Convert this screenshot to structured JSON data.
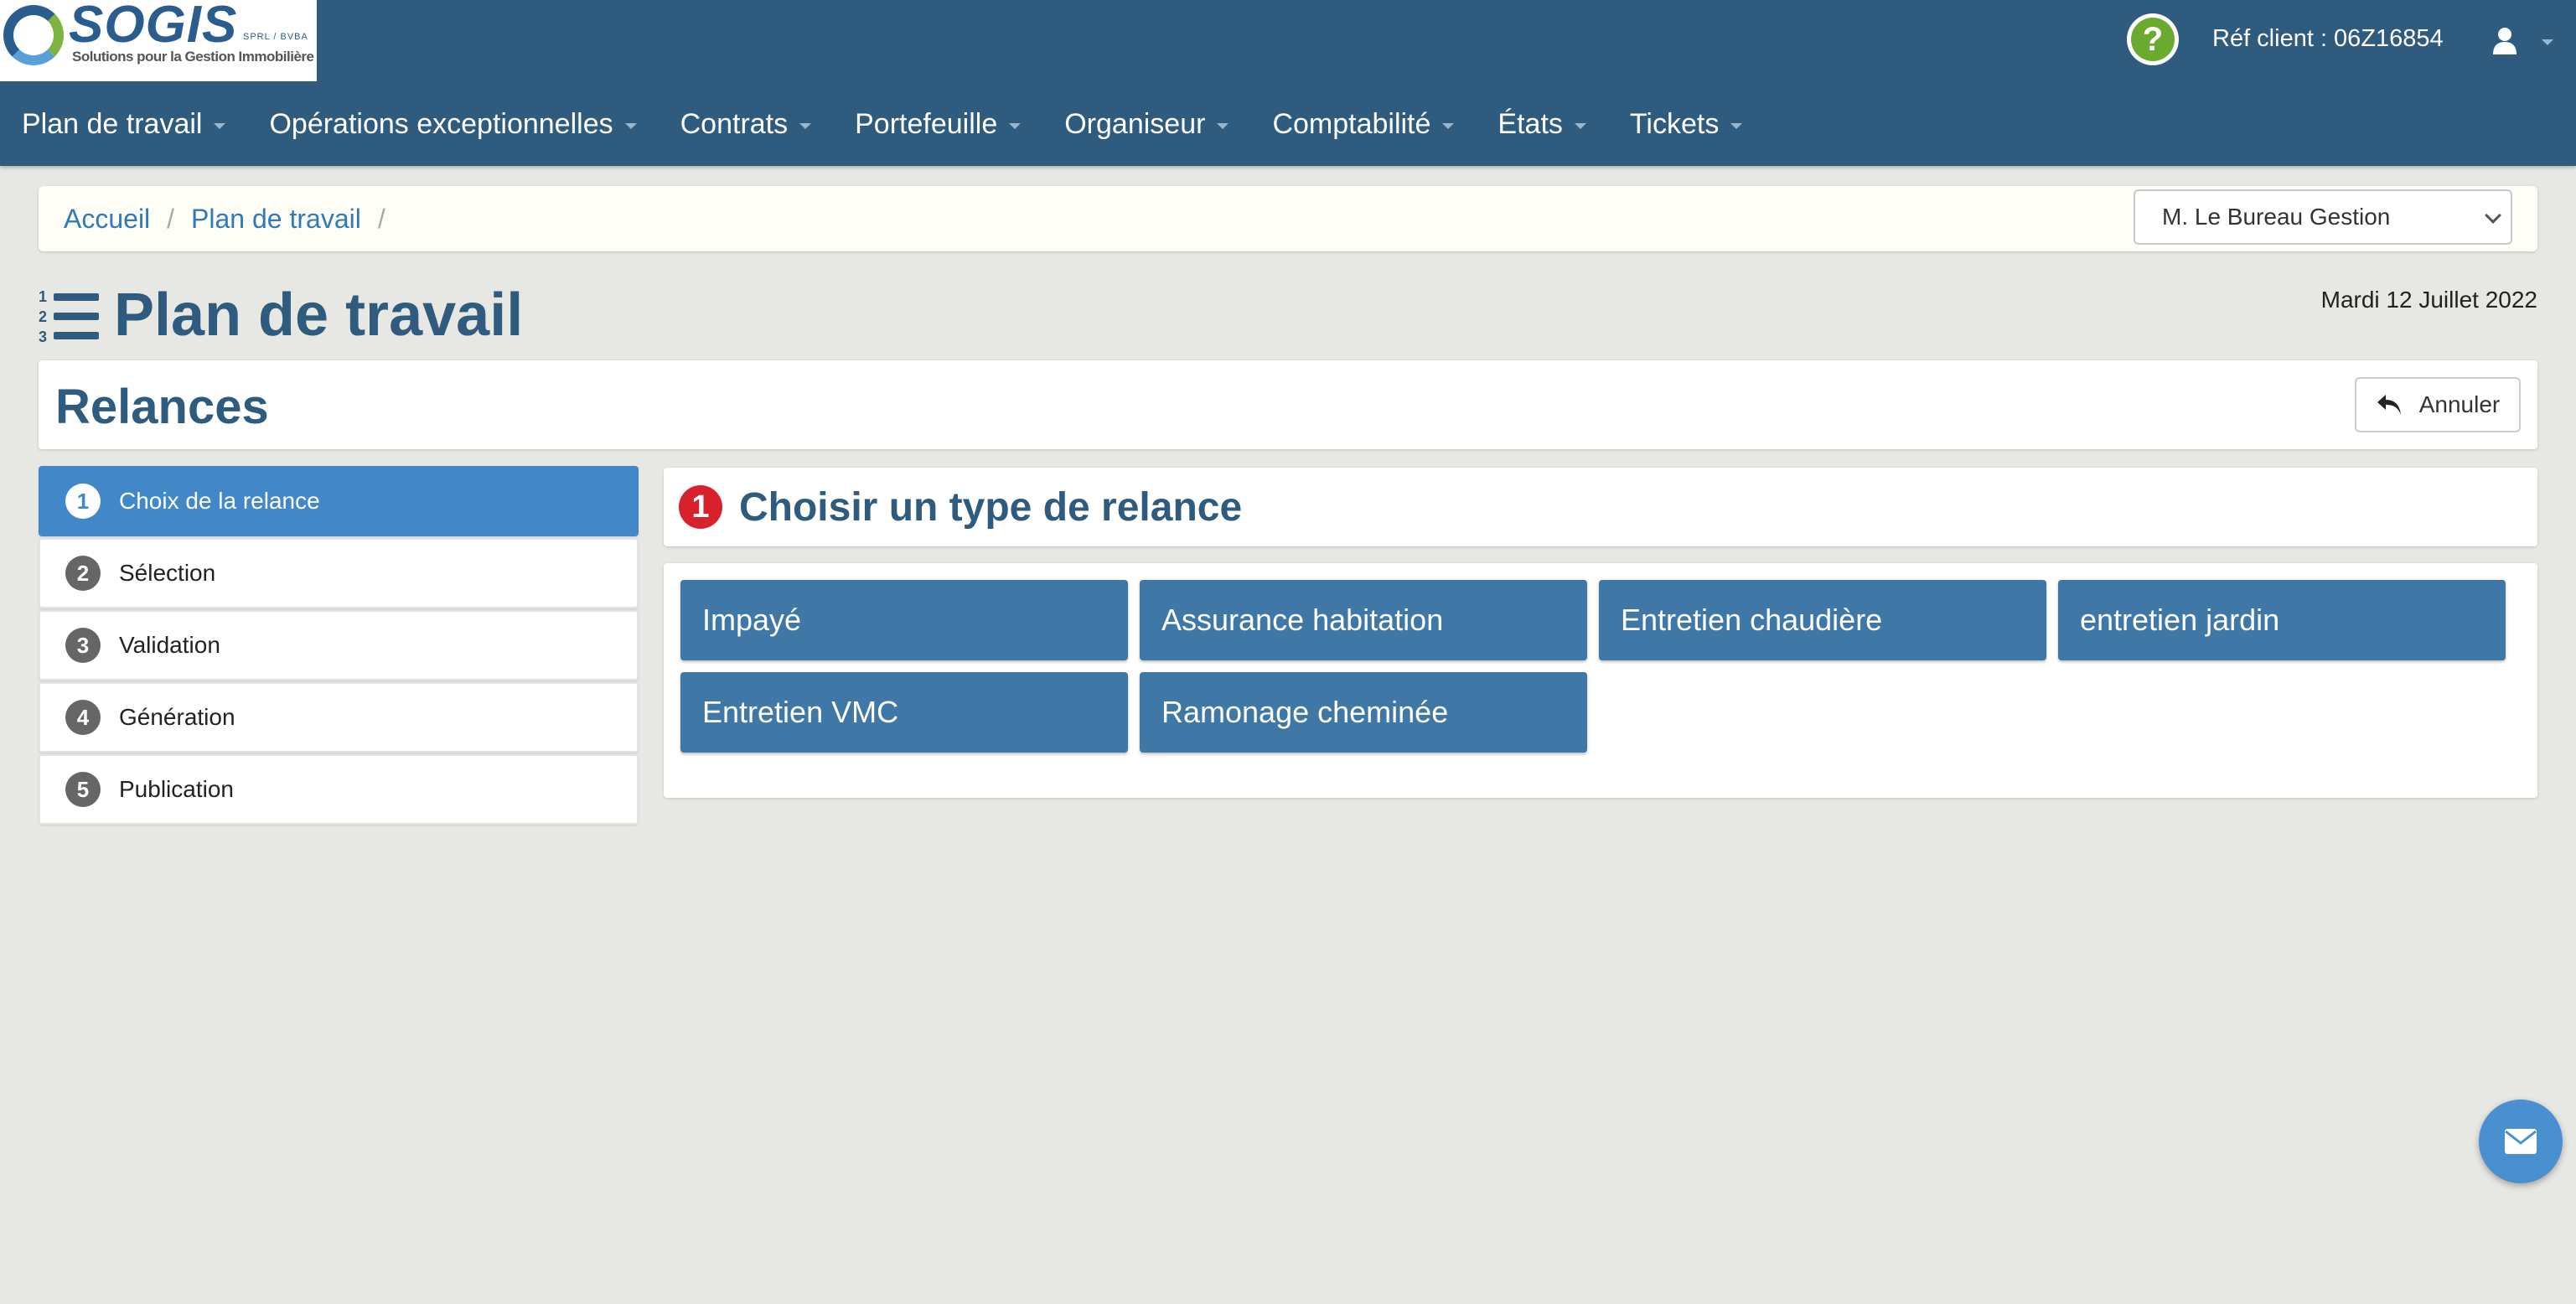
{
  "logo": {
    "name": "SOGIS",
    "subtitle": "SPRL / BVBA",
    "tagline": "Solutions pour la Gestion Immobilière et le Syndic"
  },
  "header": {
    "help_icon": "question-circle-icon",
    "ref_client": "Réf client : 06Z16854",
    "user_icon": "user-icon"
  },
  "nav": [
    {
      "label": "Plan de travail"
    },
    {
      "label": "Opérations exceptionnelles"
    },
    {
      "label": "Contrats"
    },
    {
      "label": "Portefeuille"
    },
    {
      "label": "Organiseur"
    },
    {
      "label": "Comptabilité"
    },
    {
      "label": "États"
    },
    {
      "label": "Tickets"
    }
  ],
  "breadcrumb": {
    "home": "Accueil",
    "current": "Plan de travail",
    "separator": "/"
  },
  "manager_select": {
    "value": "M. Le Bureau Gestion"
  },
  "page": {
    "title": "Plan de travail",
    "date": "Mardi 12 Juillet 2022"
  },
  "relances": {
    "title": "Relances",
    "cancel_label": "Annuler"
  },
  "steps": [
    {
      "num": "1",
      "label": "Choix de la relance",
      "active": true
    },
    {
      "num": "2",
      "label": "Sélection",
      "active": false
    },
    {
      "num": "3",
      "label": "Validation",
      "active": false
    },
    {
      "num": "4",
      "label": "Génération",
      "active": false
    },
    {
      "num": "5",
      "label": "Publication",
      "active": false
    }
  ],
  "choose": {
    "badge": "1",
    "title": "Choisir un type de relance"
  },
  "types": [
    {
      "label": "Impayé"
    },
    {
      "label": "Assurance habitation"
    },
    {
      "label": "Entretien chaudière"
    },
    {
      "label": "entretien jardin"
    },
    {
      "label": "Entretien VMC"
    },
    {
      "label": "Ramonage cheminée"
    }
  ],
  "colors": {
    "header_bg": "#2f5b7f",
    "active_step": "#4288c8",
    "type_button": "#3f77a6",
    "badge_red": "#d9212e",
    "help_green": "#6aaa2e"
  },
  "fab": {
    "icon": "envelope-icon"
  }
}
